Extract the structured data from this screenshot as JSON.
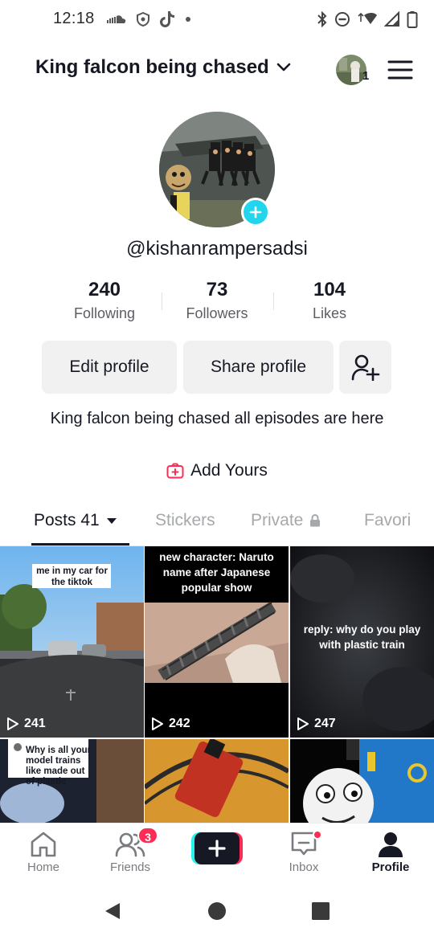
{
  "status_bar": {
    "time": "12:18",
    "left_icons": [
      "soundcloud-icon",
      "shield-icon",
      "tiktok-icon",
      "dot-icon"
    ],
    "right_icons": [
      "bluetooth-icon",
      "do-not-disturb-icon",
      "wifi-icon",
      "cell-signal-icon",
      "battery-icon"
    ]
  },
  "top_bar": {
    "account_name": "King falcon being chased",
    "account_avatar_count": "1",
    "icons": [
      "chevron-down-icon",
      "menu-icon"
    ]
  },
  "profile": {
    "username": "@kishanrampersadsi",
    "stats": [
      {
        "value": "240",
        "label": "Following"
      },
      {
        "value": "73",
        "label": "Followers"
      },
      {
        "value": "104",
        "label": "Likes"
      }
    ],
    "edit_profile_label": "Edit profile",
    "share_profile_label": "Share profile",
    "bio": "King falcon being chased all episodes are here",
    "add_yours_label": "Add Yours"
  },
  "tabs": {
    "posts_label": "Posts",
    "posts_count": "41",
    "stickers_label": "Stickers",
    "private_label": "Private",
    "favorites_label": "Favori"
  },
  "videos": [
    {
      "caption": "me in my car for the tiktok",
      "views": "241"
    },
    {
      "caption": "new character: Naruto name after Japanese popular show",
      "views": "242"
    },
    {
      "caption": "reply: why do you play with plastic train",
      "views": "247"
    },
    {
      "caption": "Why is all your model trains like made out of plastic",
      "views": ""
    },
    {
      "caption": "",
      "views": ""
    },
    {
      "caption": "",
      "views": ""
    }
  ],
  "bottom_nav": {
    "home_label": "Home",
    "friends_label": "Friends",
    "friends_badge": "3",
    "inbox_label": "Inbox",
    "profile_label": "Profile",
    "active": "Profile"
  },
  "colors": {
    "accent": "#fe2c55",
    "cyan": "#25f4ee",
    "text": "#161823",
    "muted": "#5c5d63",
    "button_bg": "#f1f1f2"
  }
}
